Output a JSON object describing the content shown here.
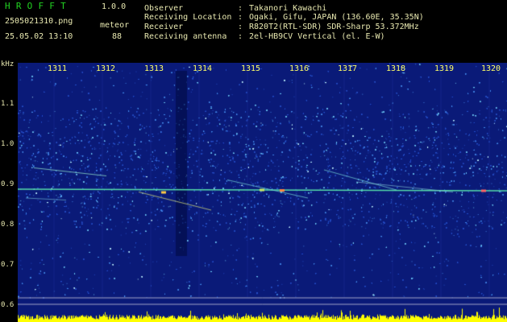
{
  "header": {
    "app_title": "HROFFT",
    "app_version": "1.0.0",
    "filename": "2505021310.png",
    "datetime": "25.05.02 13:10",
    "meteor_label": "meteor",
    "meteor_count": "88",
    "info": [
      {
        "label": "Observer",
        "value": "Takanori Kawachi"
      },
      {
        "label": "Receiving Location",
        "value": "Ogaki, Gifu, JAPAN (136.60E, 35.35N)"
      },
      {
        "label": "Receiver",
        "value": "R820T2(RTL-SDR) SDR-Sharp 53.372MHz"
      },
      {
        "label": "Receiving antenna",
        "value": "2el-HB9CV Vertical (el. E-W)"
      }
    ]
  },
  "spectrogram": {
    "y_unit": "kHz",
    "y_labels": [
      "1.1",
      "1.0",
      "0.9",
      "0.8",
      "0.7",
      "0.6"
    ],
    "x_labels": [
      "1311",
      "1312",
      "1313",
      "1314",
      "1315",
      "1316",
      "1317",
      "1318",
      "1319",
      "1320"
    ],
    "colors": {
      "background": "#0a1a78",
      "text": "#e8e8b0",
      "tick_text": "#ffff66",
      "carrier": "#55ddaa",
      "level_bar": "#ffff00"
    }
  }
}
